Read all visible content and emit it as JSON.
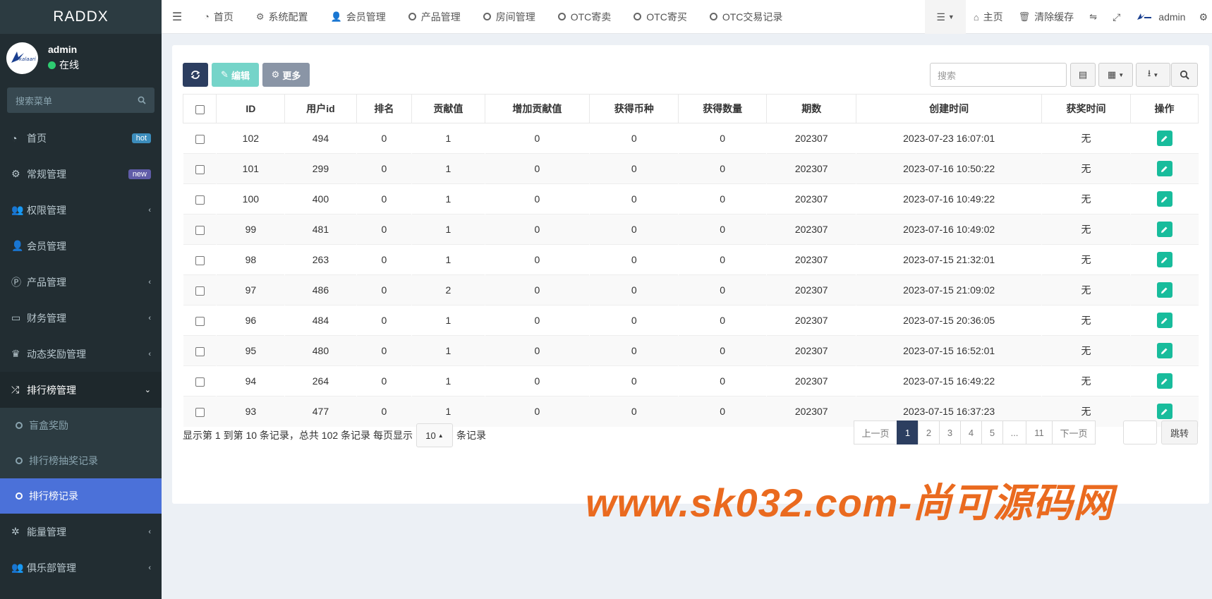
{
  "sidebar": {
    "logo": "RADDX",
    "avatar_logo_text": "kalaari",
    "user_name": "admin",
    "user_status": "在线",
    "search_placeholder": "搜索菜单",
    "menu": [
      {
        "label": "首页",
        "icon": "dashboard-icon",
        "badge": "hot"
      },
      {
        "label": "常规管理",
        "icon": "cogs-icon",
        "badge": "new"
      },
      {
        "label": "权限管理",
        "icon": "group-icon",
        "caret": "‹"
      },
      {
        "label": "会员管理",
        "icon": "user-icon"
      },
      {
        "label": "产品管理",
        "icon": "product-icon",
        "caret": "‹"
      },
      {
        "label": "财务管理",
        "icon": "credit-card-icon",
        "caret": "‹"
      },
      {
        "label": "动态奖励管理",
        "icon": "reward-icon",
        "caret": "‹"
      },
      {
        "label": "排行榜管理",
        "icon": "random-icon",
        "caret": "⌄"
      }
    ],
    "submenu": [
      {
        "label": "盲盒奖励"
      },
      {
        "label": "排行榜抽奖记录"
      },
      {
        "label": "排行榜记录"
      }
    ],
    "menu_after": [
      {
        "label": "能量管理",
        "icon": "energy-icon",
        "caret": "‹"
      },
      {
        "label": "俱乐部管理",
        "icon": "club-icon",
        "caret": "‹"
      }
    ]
  },
  "topbar": {
    "tabs": [
      "首页",
      "系统配置",
      "会员管理",
      "产品管理",
      "房间管理",
      "OTC寄卖",
      "OTC寄买",
      "OTC交易记录"
    ],
    "home": "主页",
    "clear_cache": "清除缓存",
    "admin": "admin"
  },
  "toolbar": {
    "edit_label": "编辑",
    "more_label": "更多",
    "search_placeholder": "搜索"
  },
  "table": {
    "headers": [
      "ID",
      "用户id",
      "排名",
      "贡献值",
      "增加贡献值",
      "获得币种",
      "获得数量",
      "期数",
      "创建时间",
      "获奖时间",
      "操作"
    ],
    "rows": [
      [
        "102",
        "494",
        "0",
        "1",
        "0",
        "0",
        "0",
        "202307",
        "2023-07-23 16:07:01",
        "无"
      ],
      [
        "101",
        "299",
        "0",
        "1",
        "0",
        "0",
        "0",
        "202307",
        "2023-07-16 10:50:22",
        "无"
      ],
      [
        "100",
        "400",
        "0",
        "1",
        "0",
        "0",
        "0",
        "202307",
        "2023-07-16 10:49:22",
        "无"
      ],
      [
        "99",
        "481",
        "0",
        "1",
        "0",
        "0",
        "0",
        "202307",
        "2023-07-16 10:49:02",
        "无"
      ],
      [
        "98",
        "263",
        "0",
        "1",
        "0",
        "0",
        "0",
        "202307",
        "2023-07-15 21:32:01",
        "无"
      ],
      [
        "97",
        "486",
        "0",
        "2",
        "0",
        "0",
        "0",
        "202307",
        "2023-07-15 21:09:02",
        "无"
      ],
      [
        "96",
        "484",
        "0",
        "1",
        "0",
        "0",
        "0",
        "202307",
        "2023-07-15 20:36:05",
        "无"
      ],
      [
        "95",
        "480",
        "0",
        "1",
        "0",
        "0",
        "0",
        "202307",
        "2023-07-15 16:52:01",
        "无"
      ],
      [
        "94",
        "264",
        "0",
        "1",
        "0",
        "0",
        "0",
        "202307",
        "2023-07-15 16:49:22",
        "无"
      ],
      [
        "93",
        "477",
        "0",
        "1",
        "0",
        "0",
        "0",
        "202307",
        "2023-07-15 16:37:23",
        "无"
      ]
    ]
  },
  "pager": {
    "info_prefix": "显示第 1 到第 10 条记录，总共 102 条记录 每页显示",
    "page_size": "10",
    "info_suffix": "条记录",
    "prev": "上一页",
    "pages": [
      "1",
      "2",
      "3",
      "4",
      "5",
      "...",
      "11"
    ],
    "next": "下一页",
    "jump": "跳转"
  },
  "watermark": "www.sk032.com-尚可源码网",
  "colors": {
    "sidebar_bg": "#222d32",
    "active_sub": "#4b71d9",
    "edit_btn": "#18bc9c",
    "primary_dark": "#2c3e60",
    "watermark": "#ea6a1f"
  }
}
